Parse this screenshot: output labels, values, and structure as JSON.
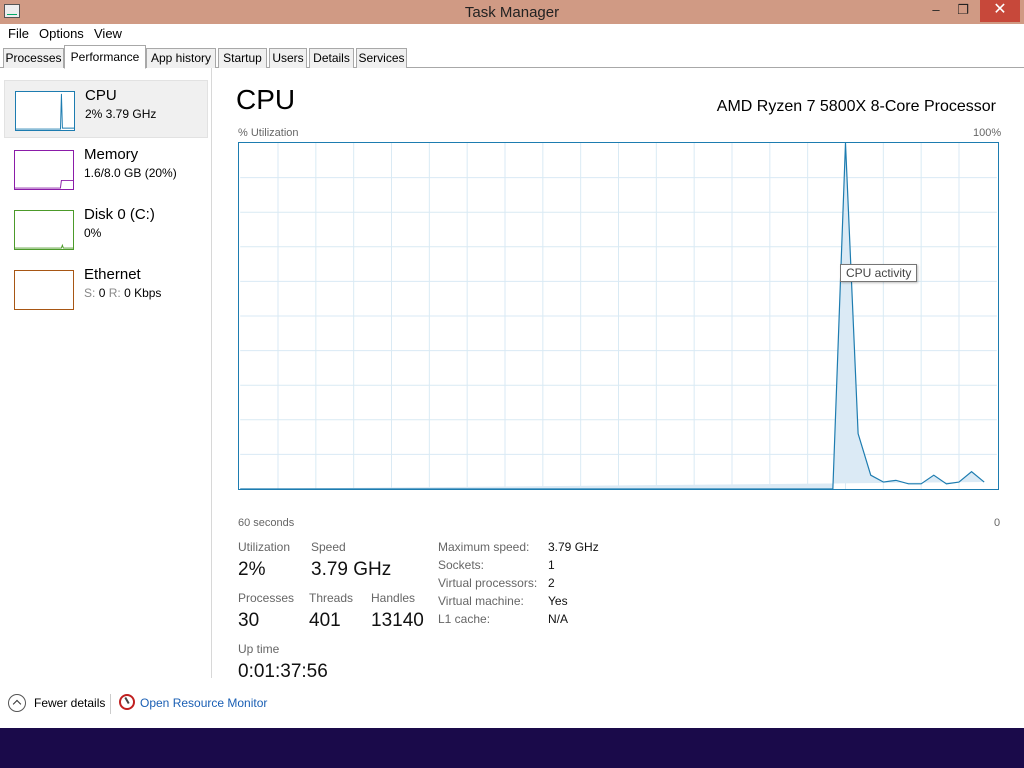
{
  "window": {
    "title": "Task Manager",
    "minimize": "–",
    "maximize": "❐",
    "close": "✕"
  },
  "menu": [
    "File",
    "Options",
    "View"
  ],
  "tabs": [
    "Processes",
    "Performance",
    "App history",
    "Startup",
    "Users",
    "Details",
    "Services"
  ],
  "active_tab": "Performance",
  "sidebar": {
    "items": [
      {
        "title": "CPU",
        "sub": "2%  3.79 GHz",
        "color": "#1d7cb0",
        "selected": true
      },
      {
        "title": "Memory",
        "sub": "1.6/8.0 GB (20%)",
        "color": "#8b1ca8"
      },
      {
        "title": "Disk 0 (C:)",
        "sub": "0%",
        "color": "#4c9a2a"
      },
      {
        "title": "Ethernet",
        "sub_s": "S:",
        "sub_s_val": "0",
        "sub_r": "R:",
        "sub_r_val": "0 Kbps",
        "color": "#a75614"
      }
    ]
  },
  "main": {
    "title": "CPU",
    "processor": "AMD Ryzen 7 5800X 8-Core Processor",
    "graph": {
      "ylabel": "% Utilization",
      "ymax_label": "100%",
      "xlabel_left": "60 seconds",
      "xlabel_right": "0",
      "tooltip": "CPU activity",
      "line_color": "#1d7cb0",
      "fill_color": "#dbeaf5",
      "grid_color": "#d9eaf4"
    },
    "stats": {
      "utilization_label": "Utilization",
      "utilization": "2%",
      "speed_label": "Speed",
      "speed": "3.79 GHz",
      "processes_label": "Processes",
      "processes": "30",
      "threads_label": "Threads",
      "threads": "401",
      "handles_label": "Handles",
      "handles": "13140",
      "uptime_label": "Up time",
      "uptime": "0:01:37:56"
    },
    "details": [
      {
        "key": "Maximum speed:",
        "value": "3.79 GHz"
      },
      {
        "key": "Sockets:",
        "value": "1"
      },
      {
        "key": "Virtual processors:",
        "value": "2"
      },
      {
        "key": "Virtual machine:",
        "value": "Yes"
      },
      {
        "key": "L1 cache:",
        "value": "N/A"
      }
    ]
  },
  "footer": {
    "fewer_details": "Fewer details",
    "resource_monitor": "Open Resource Monitor"
  },
  "chart_data": {
    "type": "area",
    "x": [
      60,
      59,
      58,
      57,
      56,
      55,
      54,
      53,
      52,
      51,
      50,
      49,
      48,
      47,
      46,
      45,
      44,
      43,
      42,
      41,
      40,
      39,
      38,
      37,
      36,
      35,
      34,
      33,
      32,
      31,
      30,
      29,
      28,
      27,
      26,
      25,
      24,
      23,
      22,
      21,
      20,
      19,
      18,
      17,
      16,
      15,
      14,
      13,
      12,
      11,
      10,
      9,
      8,
      7,
      6,
      5,
      4,
      3,
      2,
      1,
      0
    ],
    "values": [
      0,
      0,
      0,
      0,
      0,
      0,
      0,
      0,
      0,
      0,
      0,
      0,
      0,
      0,
      0,
      0,
      0,
      0,
      0,
      0,
      0,
      0,
      0,
      0,
      0,
      0,
      0,
      0,
      0,
      0,
      0,
      0,
      0,
      0,
      0,
      0,
      0,
      0,
      0,
      0,
      0,
      0,
      0,
      0,
      0,
      0,
      0,
      0,
      100,
      16,
      4,
      2,
      2.5,
      1.5,
      1.5,
      4,
      1.5,
      2,
      5,
      2
    ],
    "ylabel": "% Utilization",
    "xlabel": "60 seconds",
    "ylim": [
      0,
      100
    ],
    "xlim": [
      60,
      0
    ],
    "grid": true
  }
}
